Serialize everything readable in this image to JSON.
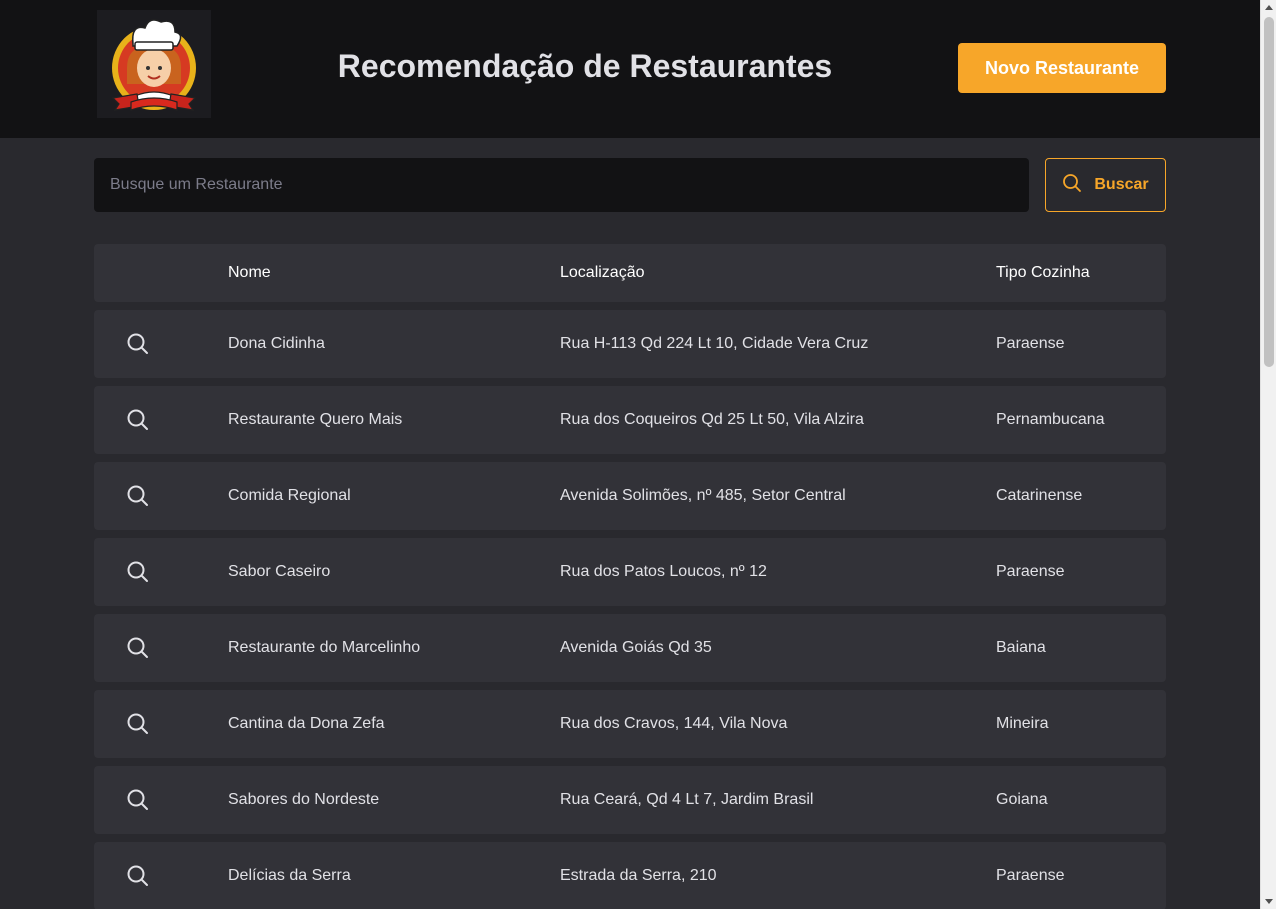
{
  "header": {
    "logo_icon": "chef-mascot-logo",
    "title": "Recomendação de Restaurantes",
    "new_button_label": "Novo Restaurante"
  },
  "search": {
    "placeholder": "Busque um Restaurante",
    "value": "",
    "button_label": "Buscar",
    "button_icon": "search-icon"
  },
  "table": {
    "columns": [
      "",
      "Nome",
      "Localização",
      "Tipo Cozinha"
    ],
    "row_icon": "search-icon",
    "rows": [
      {
        "nome": "Dona Cidinha",
        "localizacao": "Rua H-113 Qd 224 Lt 10, Cidade Vera Cruz",
        "tipo": "Paraense"
      },
      {
        "nome": "Restaurante Quero Mais",
        "localizacao": "Rua dos Coqueiros Qd 25 Lt 50, Vila Alzira",
        "tipo": "Pernambucana"
      },
      {
        "nome": "Comida Regional",
        "localizacao": "Avenida Solimões, nº 485, Setor Central",
        "tipo": "Catarinense"
      },
      {
        "nome": "Sabor Caseiro",
        "localizacao": "Rua dos Patos Loucos, nº 12",
        "tipo": "Paraense"
      },
      {
        "nome": "Restaurante do Marcelinho",
        "localizacao": "Avenida Goiás Qd 35",
        "tipo": "Baiana"
      },
      {
        "nome": "Cantina da Dona Zefa",
        "localizacao": "Rua dos Cravos, 144, Vila Nova",
        "tipo": "Mineira"
      },
      {
        "nome": "Sabores do Nordeste",
        "localizacao": "Rua Ceará, Qd 4 Lt 7, Jardim Brasil",
        "tipo": "Goiana"
      },
      {
        "nome": "Delícias da Serra",
        "localizacao": "Estrada da Serra, 210",
        "tipo": "Paraense"
      }
    ]
  },
  "colors": {
    "accent": "#f7a629",
    "header_bg": "#121214",
    "page_bg": "#29292e",
    "row_bg": "#323238"
  }
}
